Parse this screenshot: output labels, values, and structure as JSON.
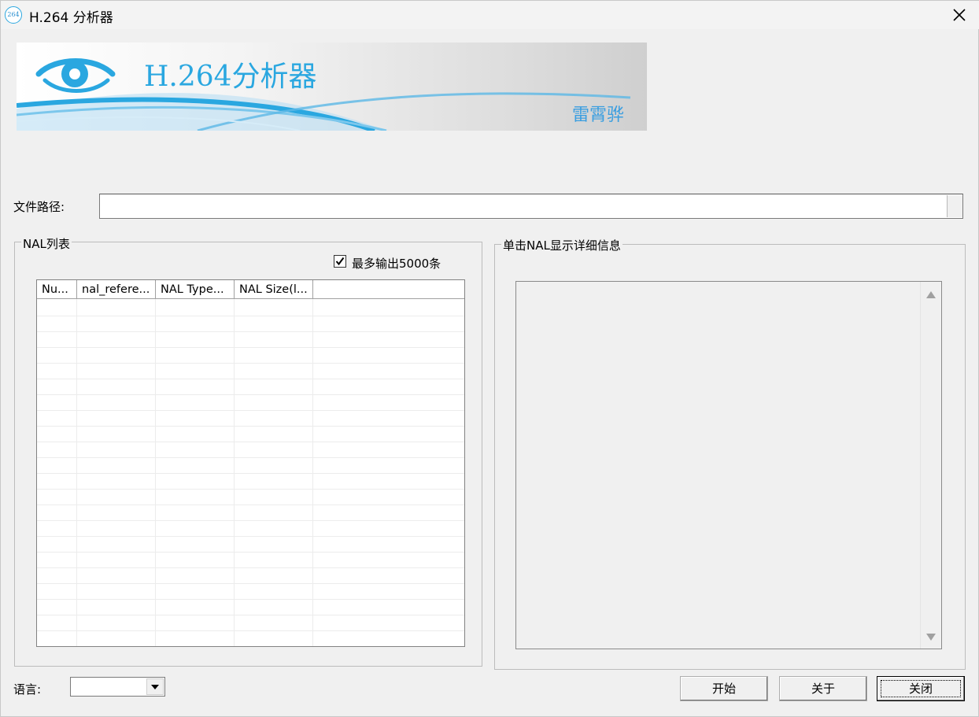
{
  "window": {
    "title": "H.264 分析器",
    "icon_text": "264"
  },
  "banner": {
    "title": "H.264分析器",
    "author": "雷霄骅",
    "accent": "#2aa7e0"
  },
  "file_path": {
    "label": "文件路径:",
    "value": ""
  },
  "nal_list": {
    "group_title": "NAL列表",
    "max_output_label": "最多输出5000条",
    "max_output_checked": true,
    "columns": [
      "Nu...",
      "nal_refere...",
      "NAL Type...",
      "NAL Size(l..."
    ],
    "rows": []
  },
  "detail": {
    "group_title": "单击NAL显示详细信息",
    "text": ""
  },
  "language": {
    "label": "语言:",
    "selected": ""
  },
  "buttons": {
    "start": "开始",
    "about": "关于",
    "close": "关闭"
  }
}
